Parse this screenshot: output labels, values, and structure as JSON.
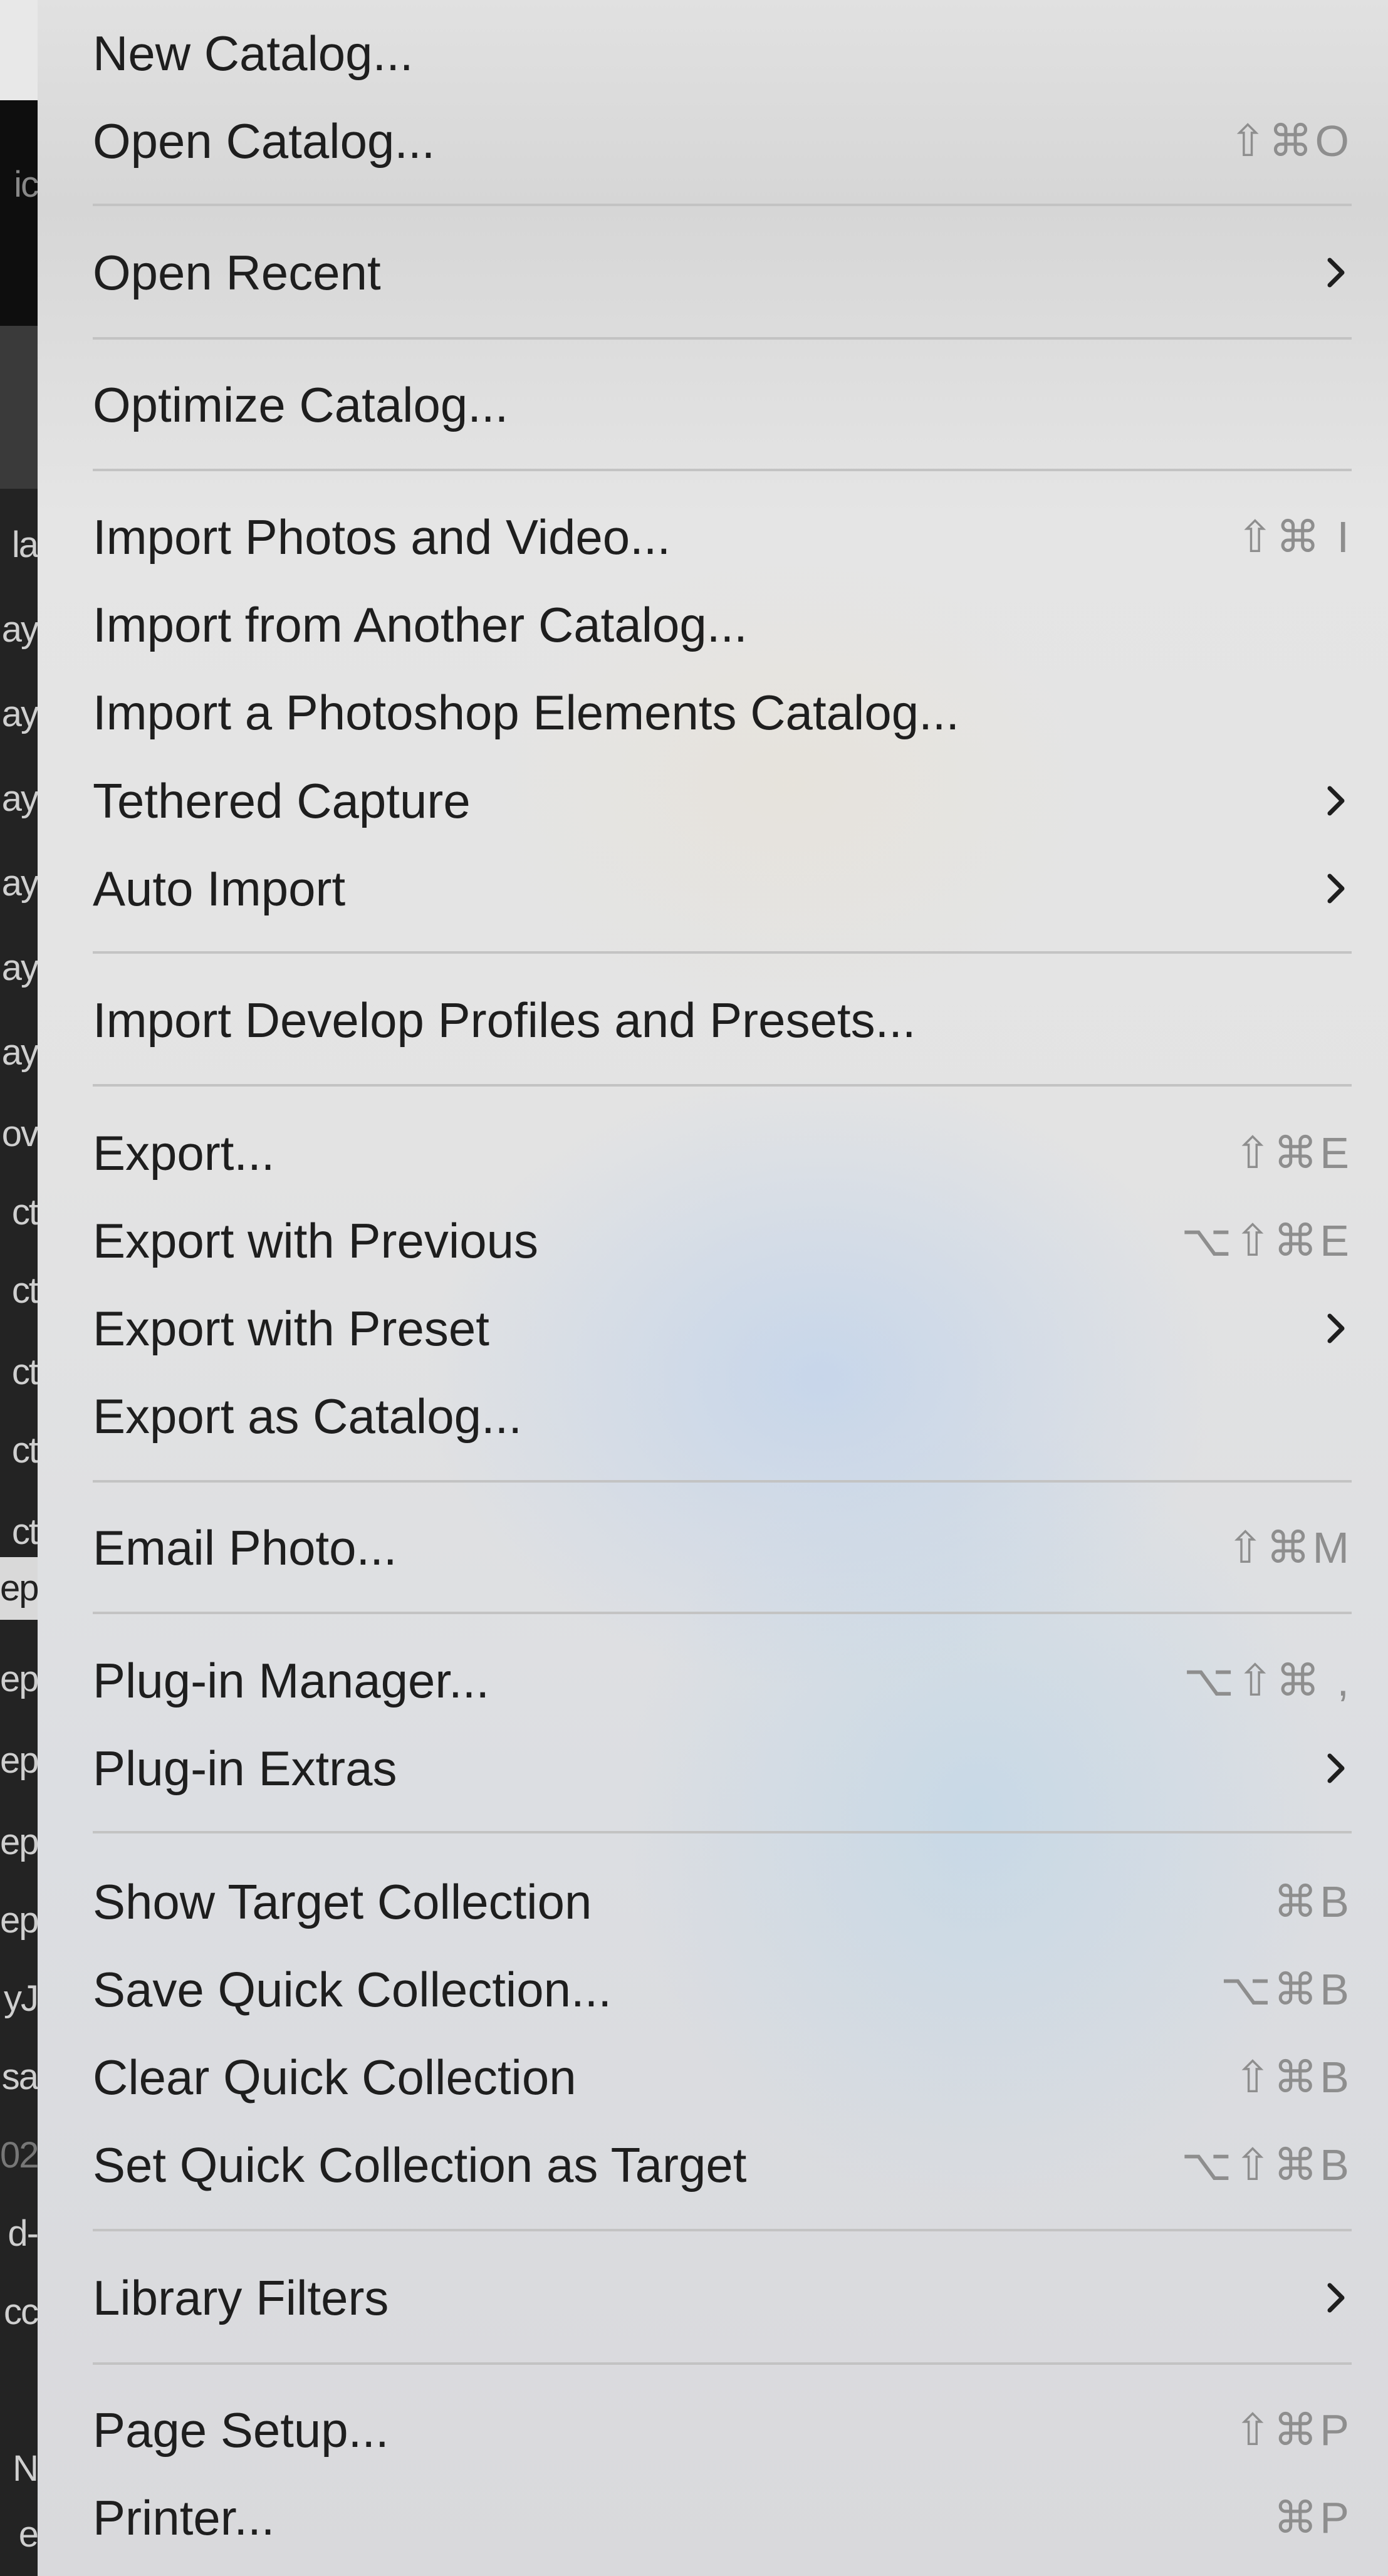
{
  "background_fragments": [
    "ic",
    "la",
    "ay",
    "ay",
    "ay",
    "ay",
    "ay",
    "ay",
    "ov",
    "ct",
    "ct",
    "ct",
    "ct",
    "ct",
    "ep",
    "ep",
    "ep",
    "ep",
    "ep",
    "yJ",
    "sa",
    "02",
    "d-",
    "cc",
    "N",
    "e"
  ],
  "menu": {
    "items": [
      {
        "label": "New Catalog...",
        "shortcut": ""
      },
      {
        "label": "Open Catalog...",
        "shortcut": "⇧⌘O"
      },
      {
        "label": "Open Recent",
        "submenu": true
      },
      {
        "label": "Optimize Catalog...",
        "shortcut": ""
      },
      {
        "label": "Import Photos and Video...",
        "shortcut": "⇧⌘ I"
      },
      {
        "label": "Import from Another Catalog...",
        "shortcut": ""
      },
      {
        "label": "Import a Photoshop Elements Catalog...",
        "shortcut": ""
      },
      {
        "label": "Tethered Capture",
        "submenu": true
      },
      {
        "label": "Auto Import",
        "submenu": true
      },
      {
        "label": "Import Develop Profiles and Presets...",
        "shortcut": ""
      },
      {
        "label": "Export...",
        "shortcut": "⇧⌘E"
      },
      {
        "label": "Export with Previous",
        "shortcut": "⌥⇧⌘E"
      },
      {
        "label": "Export with Preset",
        "submenu": true
      },
      {
        "label": "Export as Catalog...",
        "shortcut": ""
      },
      {
        "label": "Email Photo...",
        "shortcut": "⇧⌘M"
      },
      {
        "label": "Plug-in Manager...",
        "shortcut": "⌥⇧⌘ ,"
      },
      {
        "label": "Plug-in Extras",
        "submenu": true
      },
      {
        "label": "Show Target Collection",
        "shortcut": "⌘B"
      },
      {
        "label": "Save Quick Collection...",
        "shortcut": "⌥⌘B"
      },
      {
        "label": "Clear Quick Collection",
        "shortcut": "⇧⌘B"
      },
      {
        "label": "Set Quick Collection as Target",
        "shortcut": "⌥⇧⌘B"
      },
      {
        "label": "Library Filters",
        "submenu": true
      },
      {
        "label": "Page Setup...",
        "shortcut": "⇧⌘P"
      },
      {
        "label": "Printer...",
        "shortcut": "⌘P"
      }
    ]
  },
  "icons": {
    "submenu": "chevron-right-icon"
  }
}
